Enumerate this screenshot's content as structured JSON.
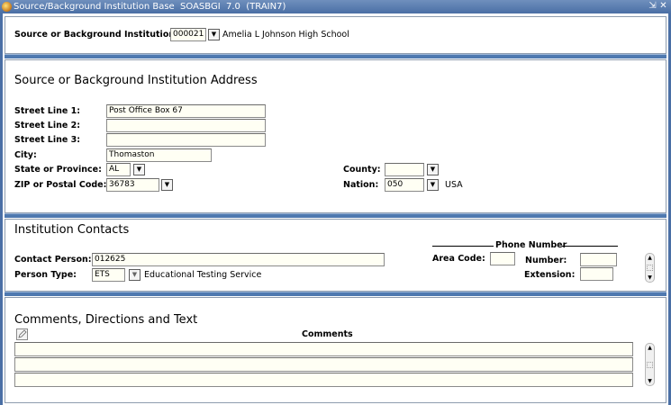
{
  "window": {
    "title": "Source/Background Institution Base  SOASBGI  7.0  (TRAIN7)",
    "minimize_glyph": "⇲",
    "close_glyph": "✕"
  },
  "key_block": {
    "label": "Source or Background Institution:",
    "code": "000021",
    "name": "Amelia L Johnson High School"
  },
  "address": {
    "heading": "Source or Background Institution Address",
    "street1_label": "Street Line 1:",
    "street1": "Post Office Box 67",
    "street2_label": "Street Line 2:",
    "street2": "",
    "street3_label": "Street Line 3:",
    "street3": "",
    "city_label": "City:",
    "city": "Thomaston",
    "state_label": "State or Province:",
    "state": "AL",
    "zip_label": "ZIP or Postal Code:",
    "zip": "36783",
    "county_label": "County:",
    "county": "",
    "nation_label": "Nation:",
    "nation": "050",
    "nation_desc": "USA"
  },
  "contacts": {
    "heading": "Institution Contacts",
    "contact_person_label": "Contact Person:",
    "contact_person": "012625",
    "person_type_label": "Person Type:",
    "person_type": "ETS",
    "person_type_desc": "Educational Testing Service",
    "phone_group_label": "Phone Number",
    "area_code_label": "Area Code:",
    "area_code": "",
    "number_label": "Number:",
    "number": "",
    "extension_label": "Extension:",
    "extension": ""
  },
  "comments": {
    "heading": "Comments, Directions and Text",
    "column_label": "Comments",
    "rows": [
      "",
      "",
      ""
    ]
  },
  "icons": {
    "dropdown": "▼",
    "scroll_up": "▲",
    "scroll_down": "▼"
  }
}
